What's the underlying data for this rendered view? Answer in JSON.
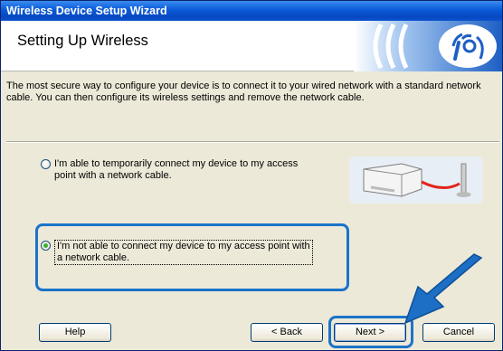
{
  "window": {
    "title": "Wireless Device Setup Wizard"
  },
  "header": {
    "title": "Setting Up Wireless",
    "graphic_icon": "wireless-signal-icon"
  },
  "description": "The most secure way to configure your device is to connect it to your wired network with a standard network cable. You can then configure its wireless settings and remove the network cable.",
  "options": [
    {
      "label_line1": "I'm able to temporarily connect my device to my access",
      "label_line2": "point with a network cable.",
      "selected": false
    },
    {
      "label_line1": "I'm not able to connect my device to my access point with",
      "label_line2": "a network cable.",
      "selected": true
    }
  ],
  "buttons": {
    "help": "Help",
    "back": "< Back",
    "next": "Next >",
    "cancel": "Cancel"
  },
  "colors": {
    "highlight": "#1b73c9",
    "titlebar": "#0a5ad8",
    "arrow": "#1c6fc4"
  }
}
